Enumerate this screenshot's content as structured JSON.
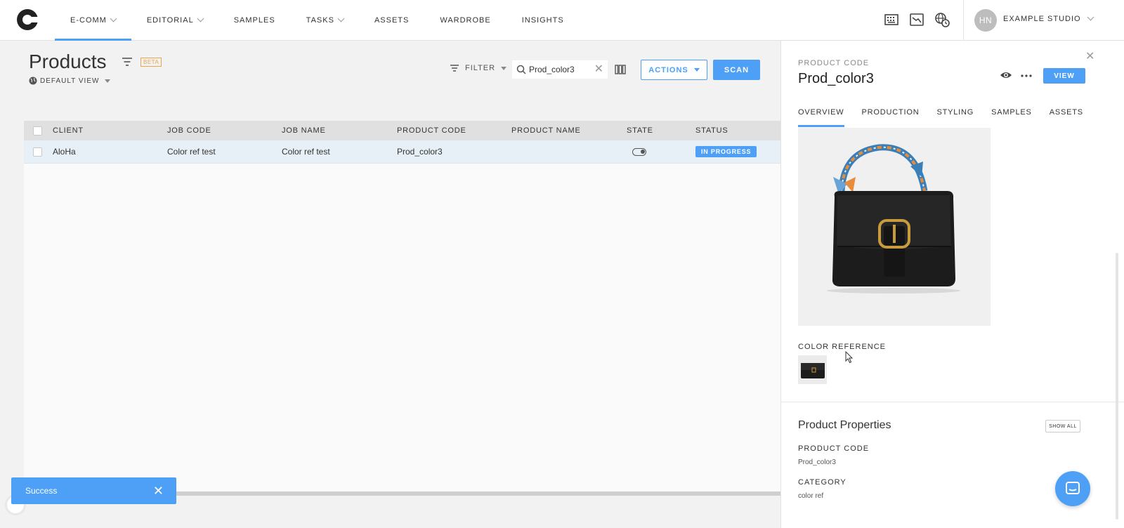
{
  "nav": {
    "items": [
      {
        "label": "E-COMM",
        "has_dropdown": true,
        "active": true
      },
      {
        "label": "EDITORIAL",
        "has_dropdown": true
      },
      {
        "label": "SAMPLES",
        "has_dropdown": false
      },
      {
        "label": "TASKS",
        "has_dropdown": true
      },
      {
        "label": "ASSETS",
        "has_dropdown": false
      },
      {
        "label": "WARDROBE",
        "has_dropdown": false
      },
      {
        "label": "INSIGHTS",
        "has_dropdown": false
      }
    ],
    "right_icons": [
      "keyboard-icon",
      "chart-icon",
      "globe-clock-icon"
    ],
    "avatar_initials": "HN",
    "studio_name": "EXAMPLE STUDIO"
  },
  "page": {
    "title": "Products",
    "beta_badge": "BETA",
    "view_label": "DEFAULT VIEW"
  },
  "toolbar": {
    "filter_label": "FILTER",
    "search_value": "Prod_color3",
    "actions_label": "ACTIONS",
    "scan_label": "SCAN"
  },
  "table": {
    "headers": [
      "CLIENT",
      "JOB CODE",
      "JOB NAME",
      "PRODUCT CODE",
      "PRODUCT NAME",
      "STATE",
      "STATUS"
    ],
    "rows": [
      {
        "client": "AloHa",
        "job_code": "Color ref test",
        "job_name": "Color ref test",
        "product_code": "Prod_color3",
        "product_name": "",
        "state": "toggle",
        "status": "IN PROGRESS"
      }
    ]
  },
  "panel": {
    "label": "PRODUCT CODE",
    "code": "Prod_color3",
    "view_label": "VIEW",
    "tabs": [
      "OVERVIEW",
      "PRODUCTION",
      "STYLING",
      "SAMPLES",
      "ASSETS"
    ],
    "active_tab": "OVERVIEW",
    "color_reference_label": "COLOR REFERENCE",
    "properties_title": "Product Properties",
    "show_all_label": "SHOW ALL",
    "properties": [
      {
        "label": "PRODUCT CODE",
        "value": "Prod_color3"
      },
      {
        "label": "CATEGORY",
        "value": "color ref"
      }
    ]
  },
  "toast": {
    "message": "Success"
  },
  "colors": {
    "accent": "#4da0f5",
    "beta": "#e8a54b",
    "row_selected": "#e6f0f6"
  }
}
